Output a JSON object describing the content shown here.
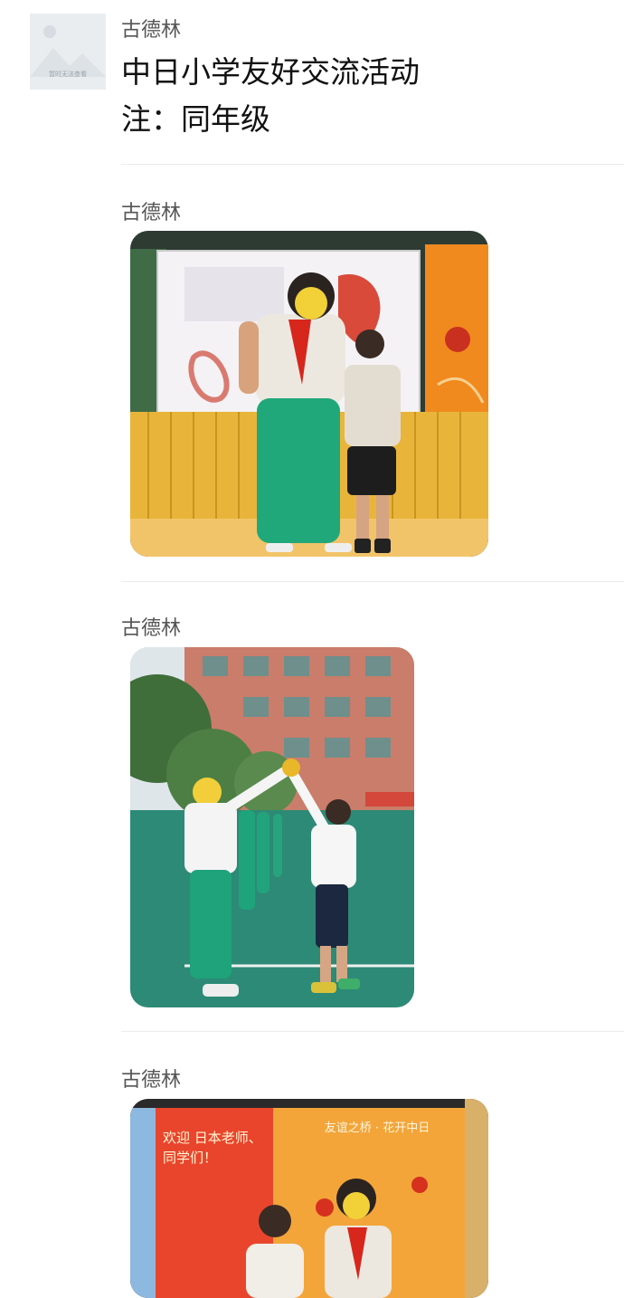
{
  "header": {
    "avatar_caption": "暂时无法查看",
    "sender": "古德林",
    "title_line1": "中日小学友好交流活动",
    "title_line2": "注：同年级"
  },
  "messages": [
    {
      "sender": "古德林",
      "image": "photo-two-students-in-front-of-board"
    },
    {
      "sender": "古德林",
      "image": "photo-students-forming-arch-on-playground"
    },
    {
      "sender": "古德林",
      "image": "photo-welcome-banner-students"
    }
  ],
  "photo3": {
    "banner_left": "欢迎 日本老师、同学们！",
    "banner_right": "友谊之桥 · 花开中日"
  },
  "colors": {
    "divider": "#ececec",
    "sender_text": "#555555",
    "title_text": "#111111"
  }
}
